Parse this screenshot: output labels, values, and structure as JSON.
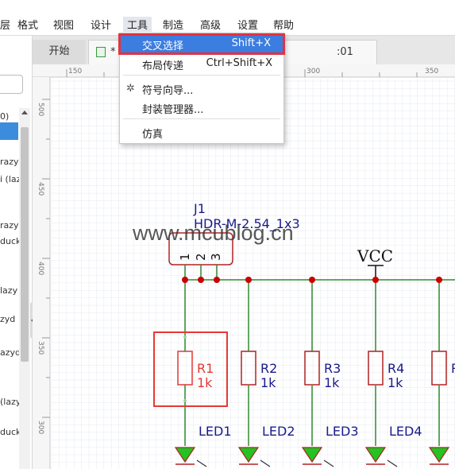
{
  "menubar": {
    "items": [
      "层",
      "格式",
      "视图",
      "设计",
      "工具",
      "制造",
      "高级",
      "设置",
      "帮助"
    ]
  },
  "left_panel": {
    "row0": "0)",
    "rows": [
      "razydu",
      "i (lazy",
      "razydu",
      "duck",
      "lazy",
      "zyd",
      "azydu",
      "(lazy",
      "duck"
    ]
  },
  "tabs": {
    "start": "开始",
    "doc_prefix": "*",
    "doc_suffix": ":01"
  },
  "ruler": {
    "h_ticks": [
      "150",
      "300",
      "350"
    ],
    "v_ticks": [
      "500",
      "450",
      "400",
      "350",
      "300"
    ]
  },
  "tools_menu": {
    "items": [
      {
        "label": "交叉选择",
        "shortcut": "Shift+X"
      },
      {
        "label": "布局传递",
        "shortcut": "Ctrl+Shift+X"
      },
      {
        "label": "符号向导...",
        "shortcut": ""
      },
      {
        "label": "封装管理器...",
        "shortcut": ""
      },
      {
        "label": "仿真",
        "shortcut": ""
      }
    ]
  },
  "schematic": {
    "connector": {
      "ref": "J1",
      "value": "HDR-M-2.54_1x3",
      "pins": [
        "1",
        "2",
        "3"
      ]
    },
    "power_label": "VCC",
    "watermark": "www.mcublog.cn",
    "resistors": [
      {
        "ref": "R1",
        "value": "1k"
      },
      {
        "ref": "R2",
        "value": "1k"
      },
      {
        "ref": "R3",
        "value": "1k"
      },
      {
        "ref": "R4",
        "value": "1k"
      },
      {
        "ref": "R",
        "value": ""
      }
    ],
    "leds": [
      "LED1",
      "LED2",
      "LED3",
      "LED4"
    ]
  },
  "colors": {
    "wire": "#2e8b2e",
    "junction": "#cc0000",
    "component": "#b22222",
    "label": "#1a1a8c",
    "selected": "#e53935",
    "grid": "#e6e9f2",
    "menu_highlight": "#3c7de0"
  }
}
